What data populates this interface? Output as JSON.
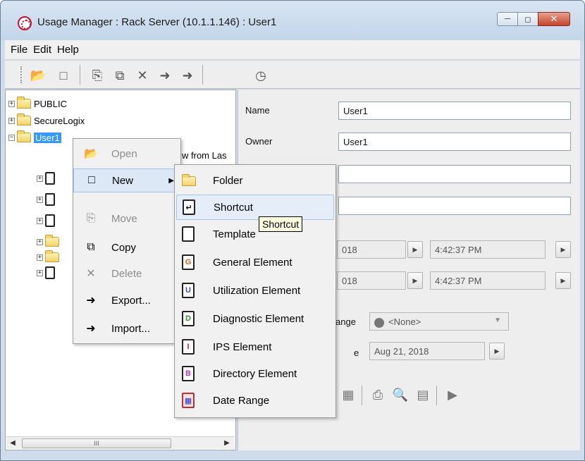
{
  "window": {
    "title": "Usage Manager : Rack Server (10.1.1.146) : User1"
  },
  "menubar": [
    "File",
    "Edit",
    "Help"
  ],
  "tree": {
    "items": [
      {
        "label": "PUBLIC"
      },
      {
        "label": "SecureLogix"
      },
      {
        "label": "User1"
      },
      {
        "label": "w from Las"
      }
    ],
    "scroll_label": "III"
  },
  "properties": {
    "name_label": "Name",
    "name_value": "User1",
    "owner_label": "Owner",
    "owner_value": "User1",
    "date1": "018",
    "time1": "4:42:37 PM",
    "date2": "018",
    "time2": "4:42:37 PM",
    "range_label": "ange",
    "range_value": "<None>",
    "expire_label": "e",
    "expire_value": "Aug 21, 2018"
  },
  "context_menu": {
    "items": [
      {
        "label": "Open",
        "icon": "open-folder-icon",
        "disabled": true
      },
      {
        "label": "New",
        "icon": "new-page-icon",
        "disabled": false
      },
      {
        "label": "Move",
        "icon": "move-icon",
        "disabled": true
      },
      {
        "label": "Copy",
        "icon": "copy-icon",
        "disabled": false
      },
      {
        "label": "Delete",
        "icon": "delete-icon",
        "disabled": true
      },
      {
        "label": "Export...",
        "icon": "export-icon",
        "disabled": false
      },
      {
        "label": "Import...",
        "icon": "import-icon",
        "disabled": false
      }
    ]
  },
  "new_submenu": {
    "items": [
      {
        "label": "Folder",
        "icon": "folder-icon"
      },
      {
        "label": "Shortcut",
        "icon": "shortcut-icon"
      },
      {
        "label": "Template",
        "icon": "template-icon"
      },
      {
        "label": "General Element",
        "icon": "general-element-icon",
        "letter": "G",
        "color": "#e05a1e"
      },
      {
        "label": "Utilization Element",
        "icon": "utilization-element-icon",
        "letter": "U",
        "color": "#3a4fd6"
      },
      {
        "label": "Diagnostic Element",
        "icon": "diagnostic-element-icon",
        "letter": "D",
        "color": "#2f9a2f"
      },
      {
        "label": "IPS Element",
        "icon": "ips-element-icon",
        "letter": "I",
        "color": "#d12020"
      },
      {
        "label": "Directory Element",
        "icon": "directory-element-icon",
        "letter": "B",
        "color": "#b03ab8"
      },
      {
        "label": "Date Range",
        "icon": "date-range-icon"
      }
    ]
  },
  "tooltip": "Shortcut"
}
